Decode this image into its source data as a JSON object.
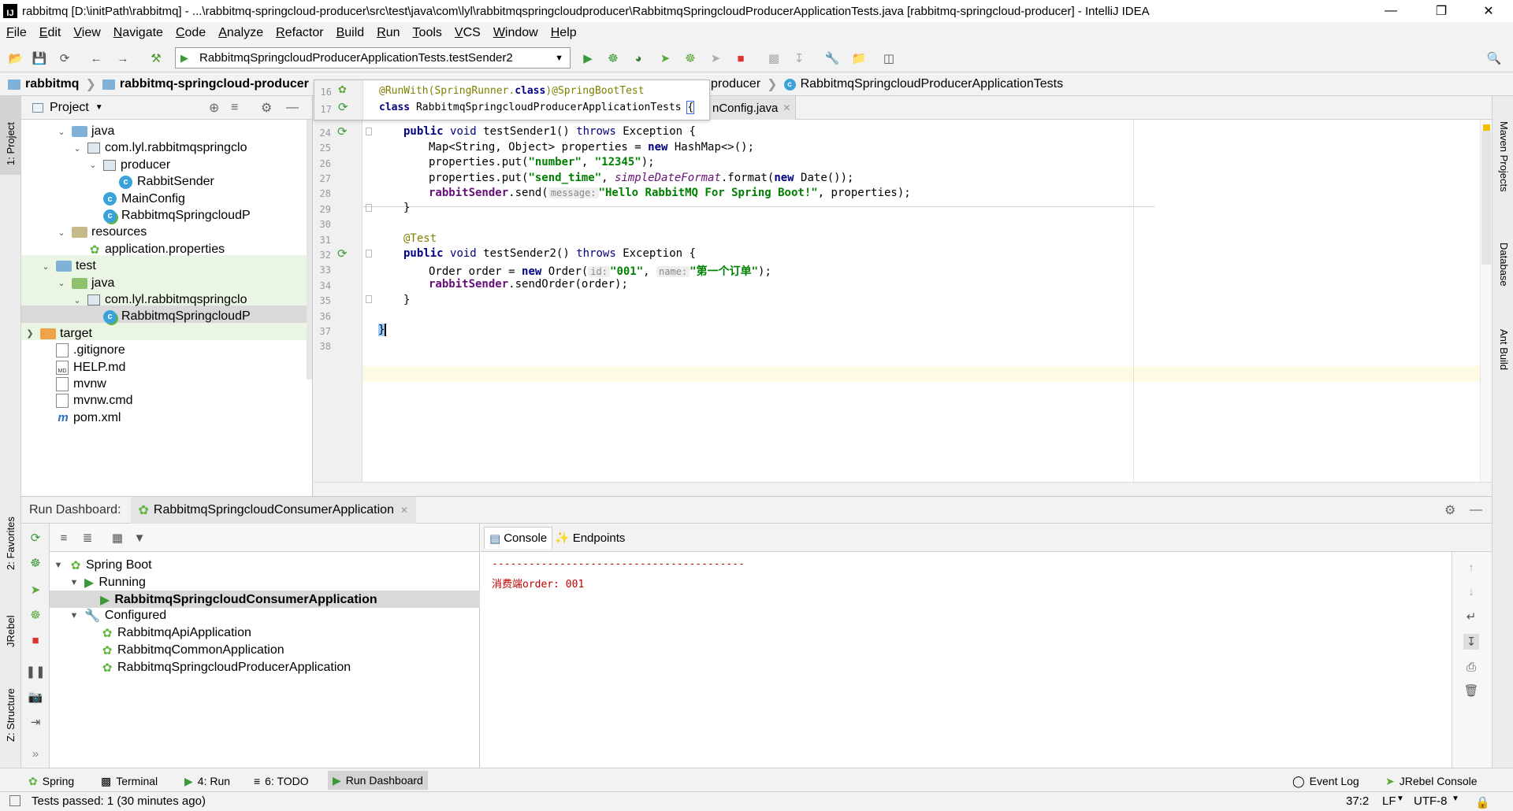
{
  "window": {
    "title": "rabbitmq [D:\\initPath\\rabbitmq] - ...\\rabbitmq-springcloud-producer\\src\\test\\java\\com\\lyl\\rabbitmqspringcloudproducer\\RabbitmqSpringcloudProducerApplicationTests.java [rabbitmq-springcloud-producer] - IntelliJ IDEA",
    "app_icon": "IJ"
  },
  "menu": [
    "File",
    "Edit",
    "View",
    "Navigate",
    "Code",
    "Analyze",
    "Refactor",
    "Build",
    "Run",
    "Tools",
    "VCS",
    "Window",
    "Help"
  ],
  "toolbar": {
    "run_config": "RabbitmqSpringcloudProducerApplicationTests.testSender2"
  },
  "breadcrumbs": {
    "root": "rabbitmq",
    "module": "rabbitmq-springcloud-producer",
    "tail_module": "producer",
    "tail_class": "RabbitmqSpringcloudProducerApplicationTests"
  },
  "stripes": {
    "left_top": "1: Project",
    "left_fav": "2: Favorites",
    "left_jrebel": "JRebel",
    "left_structure": "Z: Structure",
    "right_maven": "Maven Projects",
    "right_db": "Database",
    "right_ant": "Ant Build"
  },
  "project": {
    "header": "Project",
    "tree": [
      {
        "label": "java",
        "kind": "folder",
        "level": 4,
        "arrow": "down"
      },
      {
        "label": "com.lyl.rabbitmqspringclo",
        "kind": "package",
        "level": 5,
        "arrow": "down"
      },
      {
        "label": "producer",
        "kind": "package",
        "level": 6,
        "arrow": "down"
      },
      {
        "label": "RabbitSender",
        "kind": "class",
        "level": 7,
        "arrow": ""
      },
      {
        "label": "MainConfig",
        "kind": "class",
        "level": 6,
        "arrow": ""
      },
      {
        "label": "RabbitmqSpringcloudP",
        "kind": "springclass",
        "level": 6,
        "arrow": ""
      },
      {
        "label": "resources",
        "kind": "resfolder",
        "level": 4,
        "arrow": "down"
      },
      {
        "label": "application.properties",
        "kind": "props",
        "level": 5,
        "arrow": ""
      },
      {
        "label": "test",
        "kind": "folder",
        "level": 3,
        "arrow": "down"
      },
      {
        "label": "java",
        "kind": "testfolder",
        "level": 4,
        "arrow": "down"
      },
      {
        "label": "com.lyl.rabbitmqspringclo",
        "kind": "package",
        "level": 5,
        "arrow": "down"
      },
      {
        "label": "RabbitmqSpringcloudP",
        "kind": "springclass",
        "level": 6,
        "arrow": ""
      },
      {
        "label": "target",
        "kind": "orangefolder",
        "level": 2,
        "arrow": "right"
      },
      {
        "label": ".gitignore",
        "kind": "file",
        "level": 3,
        "arrow": ""
      },
      {
        "label": "HELP.md",
        "kind": "md",
        "level": 3,
        "arrow": ""
      },
      {
        "label": "mvnw",
        "kind": "file",
        "level": 3,
        "arrow": ""
      },
      {
        "label": "mvnw.cmd",
        "kind": "file",
        "level": 3,
        "arrow": ""
      },
      {
        "label": "pom.xml",
        "kind": "maven",
        "level": 3,
        "arrow": ""
      }
    ]
  },
  "editor": {
    "tab_partial": "nConfig.java",
    "sticky": {
      "line16": "16",
      "line17": "17",
      "ann1": "@RunWith(SpringRunner.",
      "ann1_kw": "class",
      "ann1_end": ")",
      "ann2": "@SpringBootTest",
      "cls_kw": "class",
      "cls_name": "RabbitmqSpringcloudProducerApplicationTests",
      "brace": "{"
    },
    "line_numbers": [
      "24",
      "25",
      "26",
      "27",
      "28",
      "29",
      "30",
      "31",
      "32",
      "33",
      "34",
      "35",
      "36",
      "37",
      "38"
    ],
    "code": {
      "l24_kw1": "public",
      "l24_kw2": "void",
      "l24_name": "testSender1()",
      "l24_kw3": "throws",
      "l24_rest": "Exception {",
      "l25_a": "Map<String, Object> properties = ",
      "l25_kw": "new",
      "l25_b": " HashMap<>();",
      "l26_a": "properties.put(",
      "l26_s1": "\"number\"",
      "l26_sep": ", ",
      "l26_s2": "\"12345\"",
      "l26_end": ");",
      "l27_a": "properties.put(",
      "l27_s1": "\"send_time\"",
      "l27_sep": ", ",
      "l27_it": "simpleDateFormat",
      "l27_b": ".format(",
      "l27_kw": "new",
      "l27_c": " Date());",
      "l28_fld": "rabbitSender",
      "l28_a": ".send(",
      "l28_hint": "message:",
      "l28_s": "\"Hello RabbitMQ For Spring Boot!\"",
      "l28_end": ", properties);",
      "l29": "}",
      "l31_ann": "@Test",
      "l32_kw1": "public",
      "l32_kw2": "void",
      "l32_name": "testSender2()",
      "l32_kw3": "throws",
      "l32_rest": "Exception {",
      "l33_a": "Order order = ",
      "l33_kw": "new",
      "l33_b": " Order(",
      "l33_hint1": "id:",
      "l33_s1": "\"001\"",
      "l33_sep": ", ",
      "l33_hint2": "name:",
      "l33_s2": "\"第一个订单\"",
      "l33_end": ");",
      "l34_fld": "rabbitSender",
      "l34_a": ".sendOrder(order);",
      "l35": "}",
      "l37": "}"
    }
  },
  "run_dashboard": {
    "label": "Run Dashboard:",
    "tab": "RabbitmqSpringcloudConsumerApplication",
    "tree": {
      "spring_boot": "Spring Boot",
      "running": "Running",
      "running_app": "RabbitmqSpringcloudConsumerApplication",
      "configured": "Configured",
      "configured_apps": [
        "RabbitmqApiApplication",
        "RabbitmqCommonApplication",
        "RabbitmqSpringcloudProducerApplication"
      ]
    },
    "console_tab": "Console",
    "endpoints_tab": "Endpoints",
    "console_lines": [
      "-----------------------------------------",
      "消费端order: 001"
    ]
  },
  "bottom_tools": [
    "Spring",
    "Terminal",
    "4: Run",
    "6: TODO",
    "Run Dashboard"
  ],
  "bottom_right": [
    "Event Log",
    "JRebel Console"
  ],
  "status": {
    "message": "Tests passed: 1 (30 minutes ago)",
    "position": "37:2",
    "line_sep": "LF",
    "encoding": "UTF-8"
  },
  "colors": {
    "keyword": "#000080",
    "string": "#008000",
    "annotation": "#808000",
    "field": "#660e7a",
    "console_text": "#c00000",
    "selection": "#d9d9d9",
    "test_root_bg": "#eaf5e4"
  }
}
